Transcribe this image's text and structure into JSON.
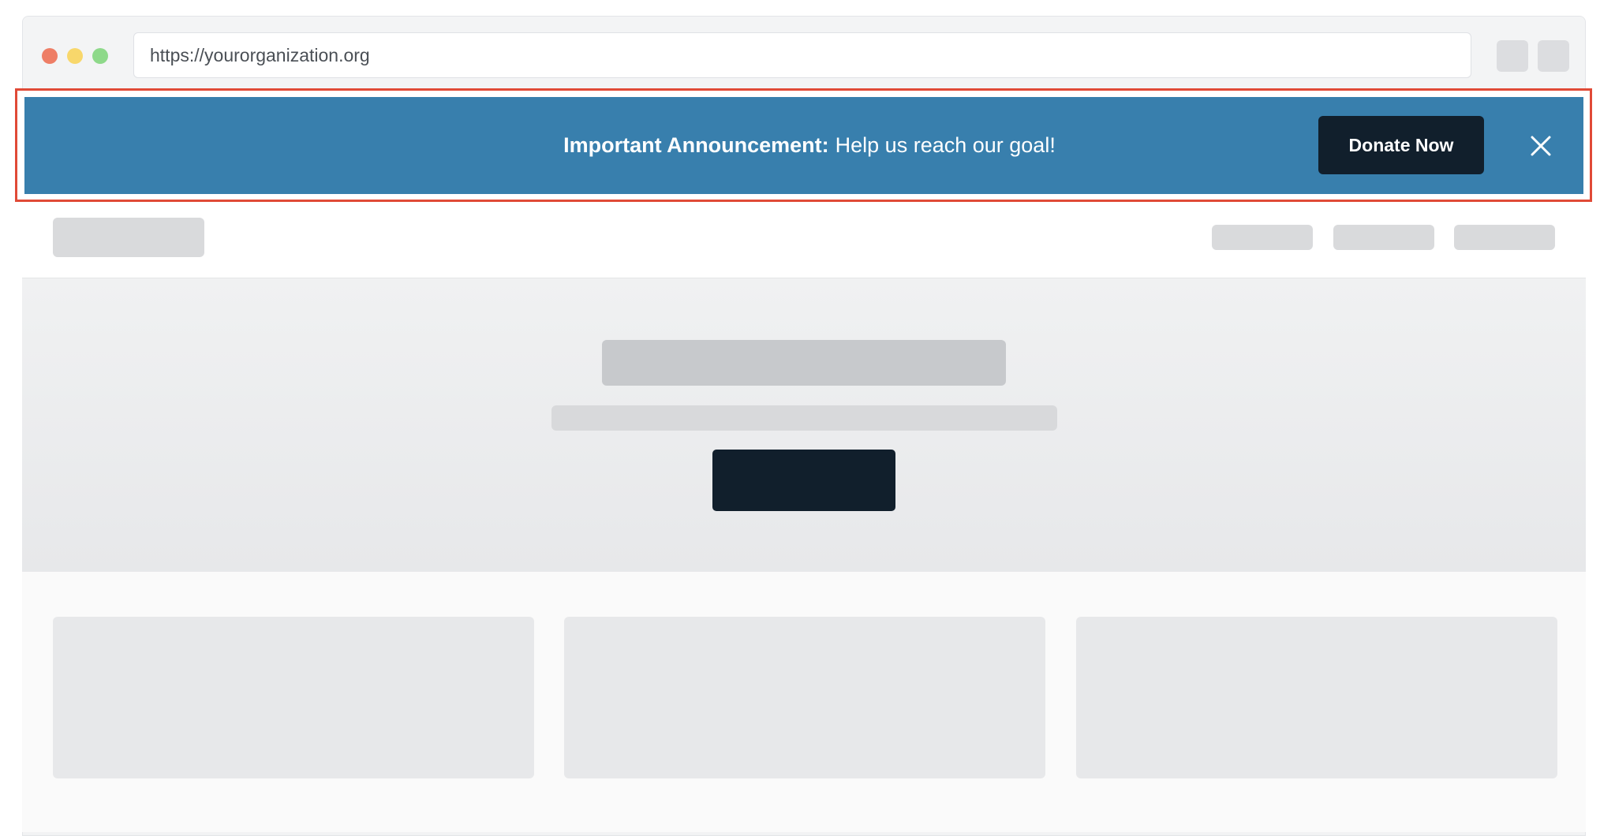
{
  "browser": {
    "url": "https://yourorganization.org"
  },
  "announcement": {
    "label": "Important Announcement:",
    "message": "Help us reach our goal!",
    "donate_label": "Donate Now",
    "close_icon": "close-icon"
  },
  "colors": {
    "banner_background": "#387fad",
    "highlight_outline": "#e04a37",
    "primary_dark": "#111f2c"
  }
}
